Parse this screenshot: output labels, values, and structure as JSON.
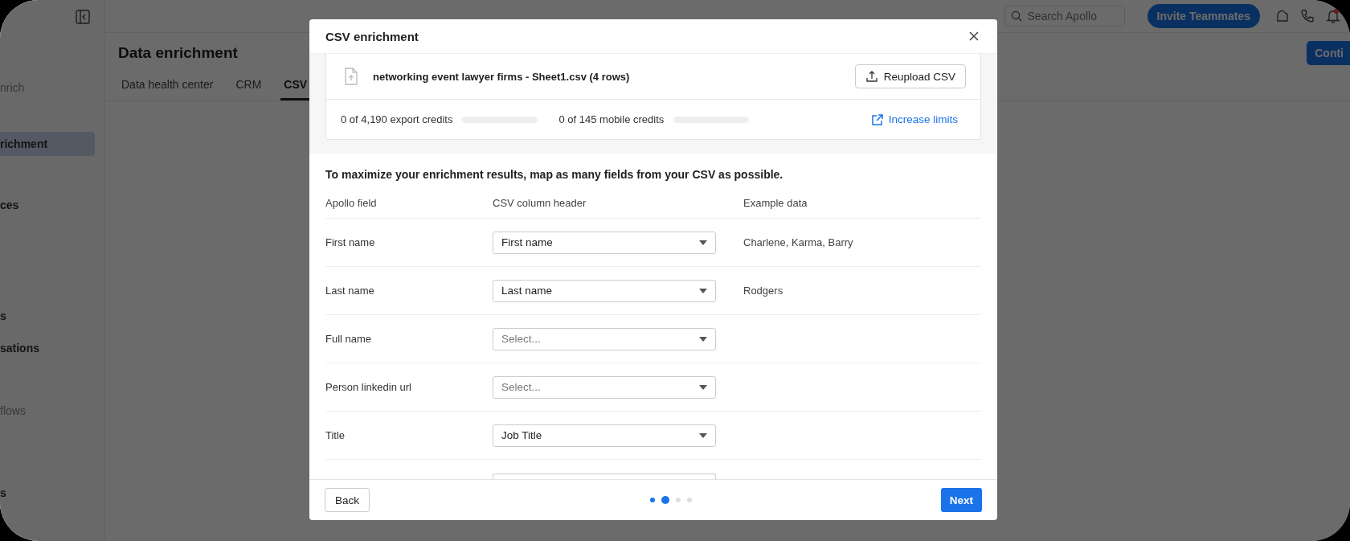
{
  "sidebar": {
    "items": [
      {
        "label": "nrich",
        "selected": false,
        "muted": true
      },
      {
        "label": "richment",
        "selected": true,
        "muted": false
      },
      {
        "label": "ces",
        "selected": false,
        "muted": false
      },
      {
        "label": "s",
        "selected": false,
        "muted": false
      },
      {
        "label": "sations",
        "selected": false,
        "muted": false
      },
      {
        "label": "flows",
        "selected": false,
        "muted": true
      },
      {
        "label": "s",
        "selected": false,
        "muted": false
      }
    ]
  },
  "topbar": {
    "search": {
      "placeholder": "Search Apollo"
    },
    "invite_button": "Invite Teammates",
    "notification_dot": true
  },
  "page": {
    "title": "Data enrichment",
    "tabs": [
      {
        "label": "Data health center",
        "selected": false
      },
      {
        "label": "CRM",
        "selected": false
      },
      {
        "label": "CSV",
        "selected": true
      }
    ],
    "action_button": "Conti"
  },
  "dialog": {
    "title": "CSV enrichment",
    "file": {
      "name": "networking event lawyer firms - Sheet1.csv (4 rows)",
      "reupload_button": "Reupload CSV"
    },
    "credits": [
      {
        "label": "0 of 4,190 export credits",
        "level": 0
      },
      {
        "label": "0 of 145 mobile credits",
        "level": 0
      }
    ],
    "increase_limits_link": "Increase limits",
    "instructions": "To maximize your enrichment results, map as many fields from your CSV as possible.",
    "columns": [
      "Apollo field",
      "CSV column header",
      "Example data"
    ],
    "rows": [
      {
        "field": "First name",
        "value": "First name",
        "example": "Charlene, Karma, Barry"
      },
      {
        "field": "Last name",
        "value": "Last name",
        "example": "Rodgers"
      },
      {
        "field": "Full name",
        "placeholder": "Select..."
      },
      {
        "field": "Person linkedin url",
        "placeholder": "Select..."
      },
      {
        "field": "Title",
        "value": "Job Title"
      }
    ],
    "clipped_row": true,
    "back_button": "Back",
    "next_button": "Next",
    "steps": [
      {
        "completed": true,
        "selected": false
      },
      {
        "completed": true,
        "selected": true
      },
      {
        "completed": false,
        "selected": false
      },
      {
        "completed": false,
        "selected": false
      }
    ]
  }
}
